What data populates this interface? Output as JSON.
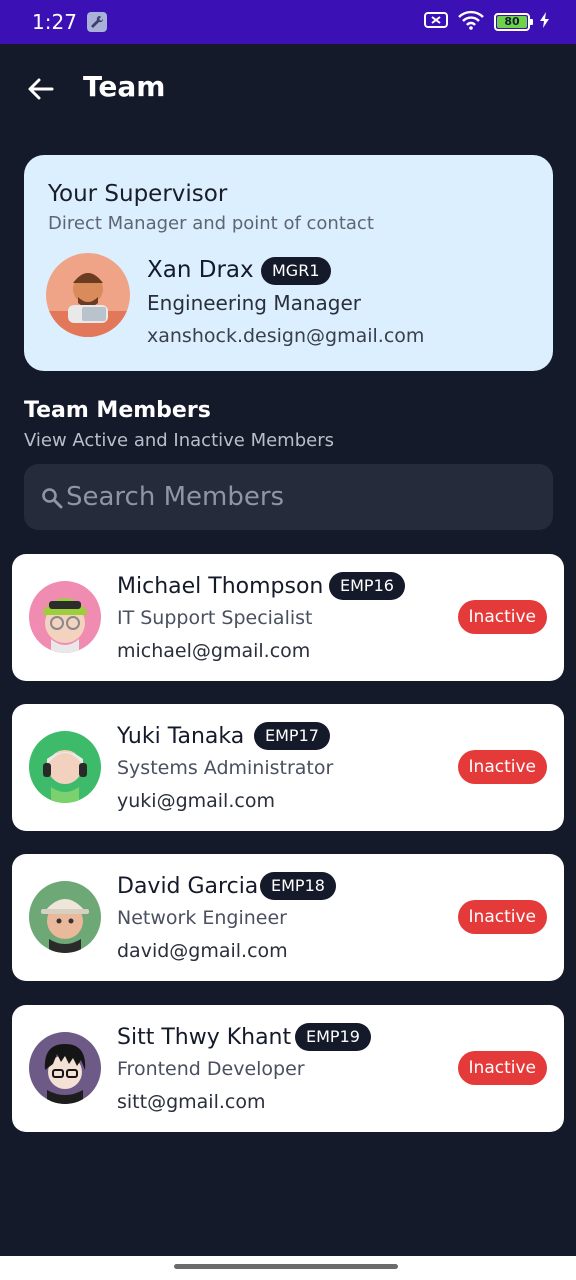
{
  "status_bar": {
    "time": "1:27",
    "battery": "80"
  },
  "app_bar": {
    "title": "Team"
  },
  "supervisor": {
    "heading": "Your Supervisor",
    "subheading": "Direct Manager and point of contact",
    "name": "Xan Drax",
    "id": "MGR1",
    "role": "Engineering Manager",
    "email": "xanshock.design@gmail.com"
  },
  "team_section": {
    "title": "Team Members",
    "subtitle": "View Active and Inactive Members"
  },
  "search": {
    "placeholder": "Search Members",
    "value": ""
  },
  "members": [
    {
      "name": "Michael Thompson",
      "id": "EMP16",
      "role": "IT Support Specialist",
      "email": "michael@gmail.com",
      "status": "Inactive"
    },
    {
      "name": "Yuki Tanaka",
      "id": "EMP17",
      "role": "Systems Administrator",
      "email": "yuki@gmail.com",
      "status": "Inactive"
    },
    {
      "name": "David Garcia",
      "id": "EMP18",
      "role": "Network Engineer",
      "email": "david@gmail.com",
      "status": "Inactive"
    },
    {
      "name": "Sitt Thwy Khant",
      "id": "EMP19",
      "role": "Frontend Developer",
      "email": "sitt@gmail.com",
      "status": "Inactive"
    }
  ],
  "colors": {
    "background": "#141a29",
    "status_bar": "#3b10b5",
    "supervisor_card": "#dcefff",
    "inactive": "#e53a3a",
    "badge": "#141a29"
  }
}
